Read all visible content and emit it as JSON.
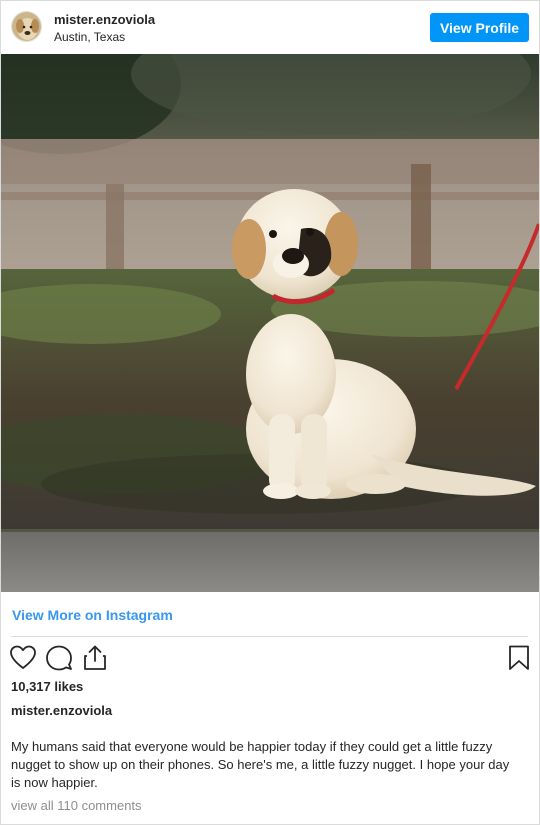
{
  "header": {
    "username": "mister.enzoviola",
    "location": "Austin, Texas",
    "view_profile_label": "View Profile"
  },
  "photo": {
    "subject": "golden retriever puppy sitting on grass with red leash"
  },
  "links": {
    "view_more_label": "View More on Instagram"
  },
  "actions": {
    "icons": [
      "heart-icon",
      "comment-icon",
      "share-icon",
      "bookmark-icon"
    ]
  },
  "post": {
    "likes": "10,317 likes",
    "caption_username": "mister.enzoviola",
    "caption": "My humans said that everyone would be happier today if they could get a little fuzzy nugget to show up on their phones. So here's me, a little fuzzy nugget. I hope your day is now happier.",
    "comments_link": "view all 110 comments"
  },
  "colors": {
    "accent": "#0095f6",
    "link": "#3897f0",
    "muted": "#8e8e8e"
  }
}
